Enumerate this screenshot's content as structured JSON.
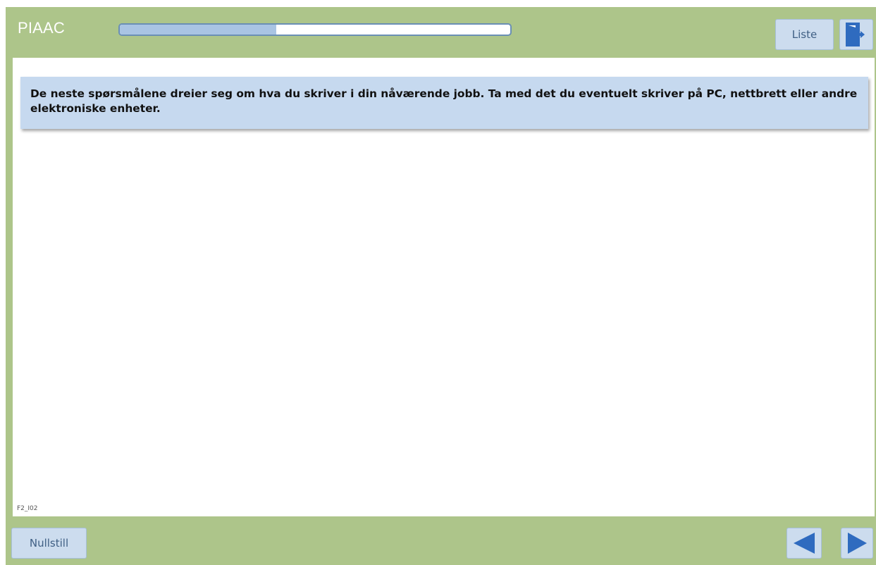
{
  "header": {
    "title": "PIAAC",
    "progress_fraction": 0.4,
    "liste_label": "Liste",
    "exit_icon": "exit-door-icon"
  },
  "content": {
    "message": "De neste spørsmålene dreier seg om hva du skriver i din nåværende jobb. Ta med det du eventuelt skriver på PC, nettbrett eller andre elektroniske enheter.",
    "screen_id": "F2_I02"
  },
  "footer": {
    "reset_label": "Nullstill",
    "prev_icon": "arrow-left-icon",
    "next_icon": "arrow-right-icon"
  },
  "colors": {
    "frame": "#adc58a",
    "button_bg": "#ccdcee",
    "icon_blue": "#2f6bbf",
    "info_bg": "#c6d9ef"
  }
}
